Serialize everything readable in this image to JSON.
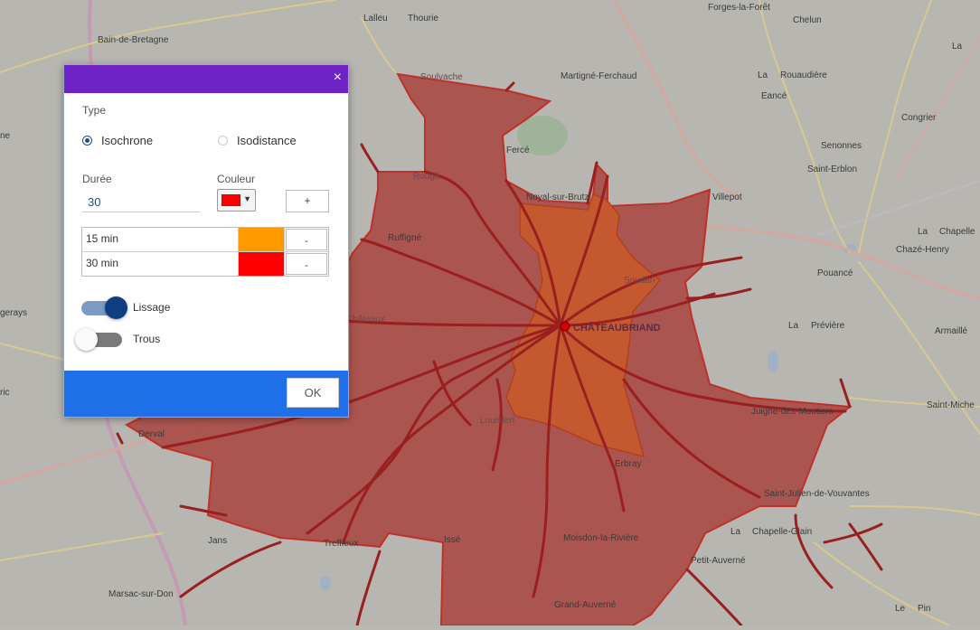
{
  "map": {
    "labels": [
      {
        "text": "Forges-la-Forêt"
      },
      {
        "text": "Chelun"
      },
      {
        "text": "Lalleu"
      },
      {
        "text": "Thourie"
      },
      {
        "text": "La"
      },
      {
        "text": "Bain-de-Bretagne"
      },
      {
        "text": "Martigné-Ferchaud"
      },
      {
        "text": "La"
      },
      {
        "text": "Rouaudière"
      },
      {
        "text": "Soulvache"
      },
      {
        "text": "Eancé"
      },
      {
        "text": "Congrier"
      },
      {
        "text": "Fercé"
      },
      {
        "text": "Senonnes"
      },
      {
        "text": "Saint-Erblon"
      },
      {
        "text": "Rougé"
      },
      {
        "text": "Noyal-sur-Brutz"
      },
      {
        "text": "Villepot"
      },
      {
        "text": "La"
      },
      {
        "text": "Chapelle"
      },
      {
        "text": "Ruffigné"
      },
      {
        "text": "Chazé-Henry"
      },
      {
        "text": "Soudan"
      },
      {
        "text": "Pouancé"
      },
      {
        "text": "Châteaux"
      },
      {
        "text": "CHÂTEAUBRIAND"
      },
      {
        "text": "La"
      },
      {
        "text": "Prévière"
      },
      {
        "text": "Armaillé"
      },
      {
        "text": "Louisfert"
      },
      {
        "text": "Juigné-des-Moutiers"
      },
      {
        "text": "Saint-Miche"
      },
      {
        "text": "Derval"
      },
      {
        "text": "Erbray"
      },
      {
        "text": "Saint-Julien-de-Vouvantes"
      },
      {
        "text": "La"
      },
      {
        "text": "Chapelle-Glain"
      },
      {
        "text": "Jans"
      },
      {
        "text": "Treffieux"
      },
      {
        "text": "Issé"
      },
      {
        "text": "Moisdon-la-Rivière"
      },
      {
        "text": "Petit-Auverné"
      },
      {
        "text": "Marsac-sur-Don"
      },
      {
        "text": "Grand-Auverné"
      },
      {
        "text": "Le"
      },
      {
        "text": "Pin"
      },
      {
        "text": "ne"
      },
      {
        "text": "gerays"
      },
      {
        "text": "ric"
      }
    ]
  },
  "dialog": {
    "close_label": "×",
    "type_label": "Type",
    "options": [
      {
        "label": "Isochrone",
        "selected": true
      },
      {
        "label": "Isodistance",
        "selected": false
      }
    ],
    "duration_label": "Durée",
    "duration_value": "30",
    "color_label": "Couleur",
    "color_value": "#ff0000",
    "color_arrow": "▼",
    "add_label": "+",
    "rows": [
      {
        "label": "15 min",
        "color": "#ff9900",
        "remove": "-"
      },
      {
        "label": "30 min",
        "color": "#ff0000",
        "remove": "-"
      }
    ],
    "toggles": [
      {
        "label": "Lissage",
        "on": true
      },
      {
        "label": "Trous",
        "on": false
      }
    ],
    "ok_label": "OK"
  }
}
